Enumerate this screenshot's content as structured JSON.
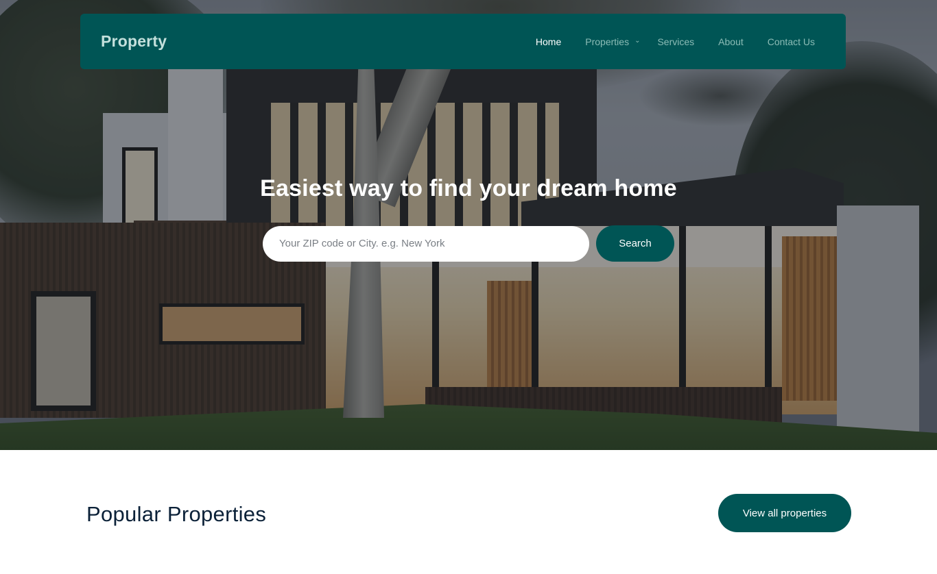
{
  "navbar": {
    "brand": "Property",
    "items": [
      {
        "label": "Home",
        "active": true
      },
      {
        "label": "Properties",
        "has_dropdown": true
      },
      {
        "label": "Services"
      },
      {
        "label": "About"
      },
      {
        "label": "Contact Us"
      }
    ],
    "dropdown_icon": "chevron-down-icon"
  },
  "hero": {
    "title": "Easiest way to find your dream home",
    "background": "modern-house-photo",
    "search": {
      "placeholder": "Your ZIP code or City. e.g. New York",
      "value": "",
      "button_label": "Search"
    }
  },
  "popular": {
    "title": "Popular Properties",
    "view_all_label": "View all properties"
  },
  "colors": {
    "brand": "#005555",
    "brand_text": "#c4e0dc",
    "nav_inactive": "#8cbcb6",
    "heading": "#0b2138"
  }
}
